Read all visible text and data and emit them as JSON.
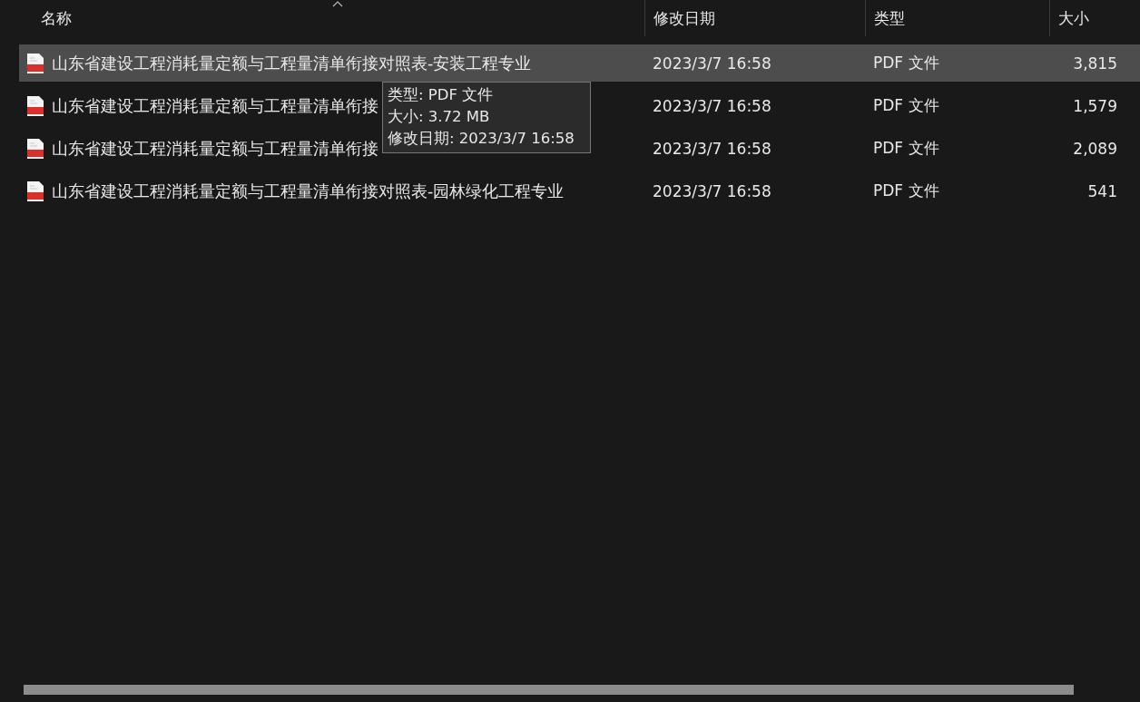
{
  "columns": [
    {
      "label": "名称",
      "sorted": true
    },
    {
      "label": "修改日期",
      "sorted": false
    },
    {
      "label": "类型",
      "sorted": false
    },
    {
      "label": "大小",
      "sorted": false
    }
  ],
  "rows": [
    {
      "name": "山东省建设工程消耗量定额与工程量清单衔接对照表-安装工程专业",
      "date": "2023/3/7 16:58",
      "type": "PDF 文件",
      "size": "3,815",
      "selected": true
    },
    {
      "name": "山东省建设工程消耗量定额与工程量清单衔接",
      "date": "2023/3/7 16:58",
      "type": "PDF 文件",
      "size": "1,579",
      "selected": false
    },
    {
      "name": "山东省建设工程消耗量定额与工程量清单衔接",
      "date": "2023/3/7 16:58",
      "type": "PDF 文件",
      "size": "2,089",
      "selected": false
    },
    {
      "name": "山东省建设工程消耗量定额与工程量清单衔接对照表-园林绿化工程专业",
      "date": "2023/3/7 16:58",
      "type": "PDF 文件",
      "size": "541",
      "selected": false
    }
  ],
  "tooltip": {
    "lines": [
      "类型: PDF 文件",
      "大小: 3.72 MB",
      "修改日期: 2023/3/7 16:58"
    ]
  }
}
